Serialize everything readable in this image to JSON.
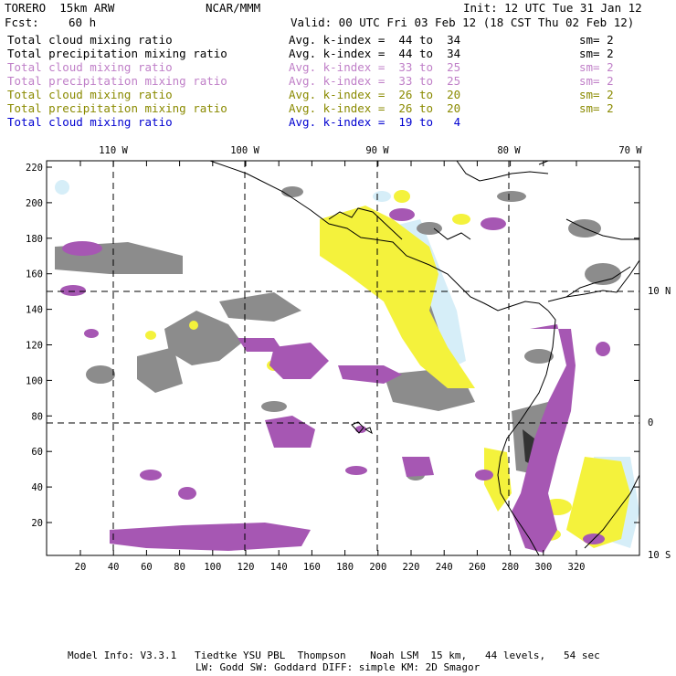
{
  "header": {
    "model": "TORERO  15km ARW",
    "center": "NCAR/MMM",
    "init": "Init: 12 UTC Tue 31 Jan 12",
    "fcst_label": "Fcst:",
    "fcst_value": "60 h",
    "valid": "Valid: 00 UTC Fri 03 Feb 12 (18 CST Thu 02 Feb 12)"
  },
  "fields": [
    {
      "name": "Total cloud mixing ratio",
      "kindex": "Avg. k-index =  44 to  34",
      "sm": "sm= 2",
      "color": "#000000"
    },
    {
      "name": "Total precipitation mixing ratio",
      "kindex": "Avg. k-index =  44 to  34",
      "sm": "sm= 2",
      "color": "#000000"
    },
    {
      "name": "Total cloud mixing ratio",
      "kindex": "Avg. k-index =  33 to  25",
      "sm": "sm= 2",
      "color": "#c080c8"
    },
    {
      "name": "Total precipitation mixing ratio",
      "kindex": "Avg. k-index =  33 to  25",
      "sm": "sm= 2",
      "color": "#c080c8"
    },
    {
      "name": "Total cloud mixing ratio",
      "kindex": "Avg. k-index =  26 to  20",
      "sm": "sm= 2",
      "color": "#8a8a00"
    },
    {
      "name": "Total precipitation mixing ratio",
      "kindex": "Avg. k-index =  26 to  20",
      "sm": "sm= 2",
      "color": "#8a8a00"
    },
    {
      "name": "Total cloud mixing ratio",
      "kindex": "Avg. k-index =  19 to   4",
      "sm": "",
      "color": "#0000d0"
    }
  ],
  "map": {
    "lon_labels": [
      "110 W",
      "100 W",
      "90 W",
      "80 W",
      "70 W"
    ],
    "lat_labels": [
      "10 N",
      "0",
      "10 S"
    ],
    "x_ticks": [
      "20",
      "40",
      "60",
      "80",
      "100",
      "120",
      "140",
      "160",
      "180",
      "200",
      "220",
      "240",
      "260",
      "280",
      "300",
      "320"
    ],
    "y_ticks": [
      "20",
      "40",
      "60",
      "80",
      "100",
      "120",
      "140",
      "160",
      "180",
      "200",
      "220"
    ],
    "colors": {
      "gray": "#8c8c8c",
      "purple": "#a657b3",
      "yellow": "#f4f23c",
      "lightblue": "#d6eef8",
      "coast": "#000000",
      "grid": "#000000"
    }
  },
  "footer": {
    "line1": "Model Info: V3.3.1   Tiedtke YSU PBL  Thompson    Noah LSM  15 km,   44 levels,   54 sec",
    "line2": "LW: Godd SW: Goddard DIFF: simple KM: 2D Smagor"
  }
}
